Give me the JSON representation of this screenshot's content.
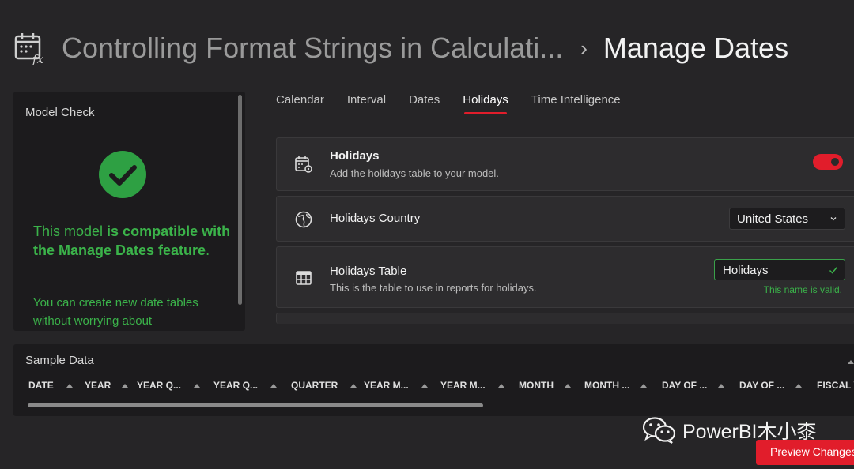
{
  "header": {
    "app_icon": "calendar-fx-icon",
    "breadcrumb": "Controlling Format Strings in Calculati...",
    "separator": "›",
    "title": "Manage Dates"
  },
  "model_check": {
    "title": "Model Check",
    "status_icon": "check-circle-icon",
    "status_color": "#3bb34a",
    "message_prefix": "This model ",
    "message_bold": "is compatible with the Manage Dates feature",
    "message_suffix": ".",
    "sub_message": "You can create new date tables without worrying about"
  },
  "tabs": [
    {
      "label": "Calendar",
      "active": false
    },
    {
      "label": "Interval",
      "active": false
    },
    {
      "label": "Dates",
      "active": false
    },
    {
      "label": "Holidays",
      "active": true
    },
    {
      "label": "Time Intelligence",
      "active": false
    }
  ],
  "settings": {
    "holidays": {
      "icon": "calendar-gear-icon",
      "title": "Holidays",
      "description": "Add the holidays table to your model.",
      "enabled": true
    },
    "country": {
      "icon": "globe-icon",
      "title": "Holidays Country",
      "selected": "United States"
    },
    "table": {
      "icon": "table-icon",
      "title": "Holidays Table",
      "description": "This is the table to use in reports for holidays.",
      "value": "Holidays",
      "validation": "This name is valid."
    }
  },
  "sample_data": {
    "title": "Sample Data",
    "columns": [
      "DATE",
      "YEAR",
      "YEAR Q...",
      "YEAR Q...",
      "QUARTER",
      "YEAR M...",
      "YEAR M...",
      "MONTH",
      "MONTH ...",
      "DAY OF ...",
      "DAY OF ...",
      "FISCAL Y"
    ]
  },
  "watermark": {
    "icon": "wechat-icon",
    "text": "PowerBI木小桼"
  },
  "footer": {
    "preview_label": "Preview Changes"
  },
  "colors": {
    "accent": "#e11d2b",
    "success": "#3bb34a",
    "background": "#262527",
    "panel": "#1c1b1d"
  }
}
